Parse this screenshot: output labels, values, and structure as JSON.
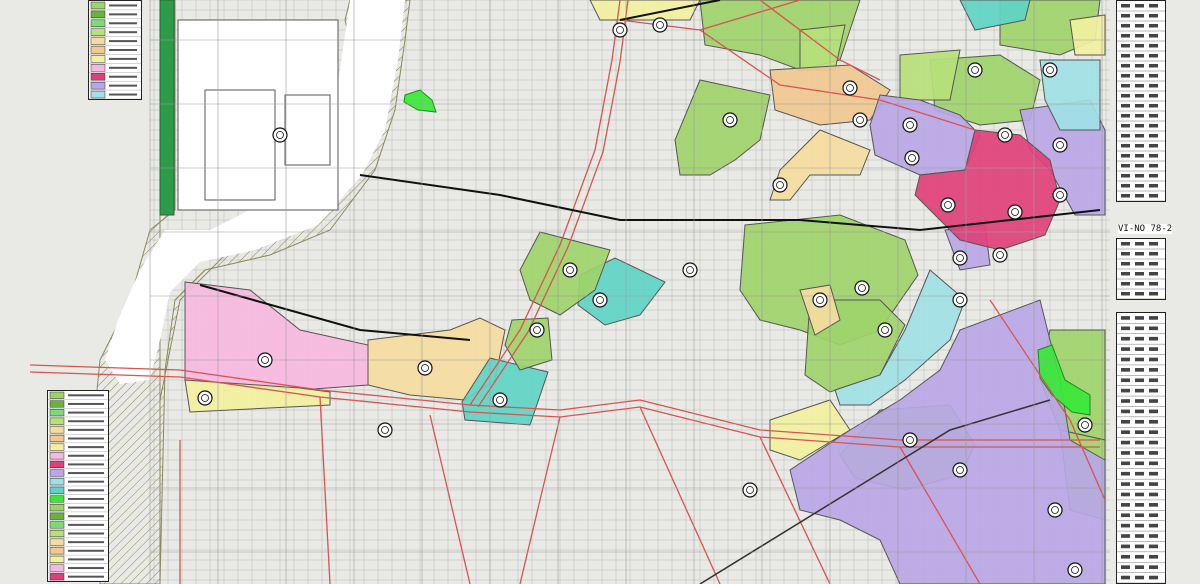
{
  "map": {
    "sheet_number": "VI-NO 78-2",
    "colors": {
      "residential_1_low": "#9ed36a",
      "residential_2_low": "#64b53a",
      "residential_1_mid": "#7fd97a",
      "residential_mid_high": "#b6e07a",
      "residential_1": "#f4dca0",
      "residential_2": "#f0c890",
      "quasi_residential": "#f2f0a0",
      "neighborhood_commercial": "#f6b8e0",
      "commercial": "#e0407a",
      "quasi_industrial": "#b9a6e6",
      "industrial": "#9fe0e6",
      "exclusive_industrial": "#5fd4c6",
      "park": "#38e838",
      "river_embankment": "#cfca8a",
      "road_red": "#d9534f",
      "urban_base": "#e9e9e6",
      "river_water": "#ffffff"
    },
    "legend_top_rows": 11,
    "legend_bottom_rows": 22
  }
}
